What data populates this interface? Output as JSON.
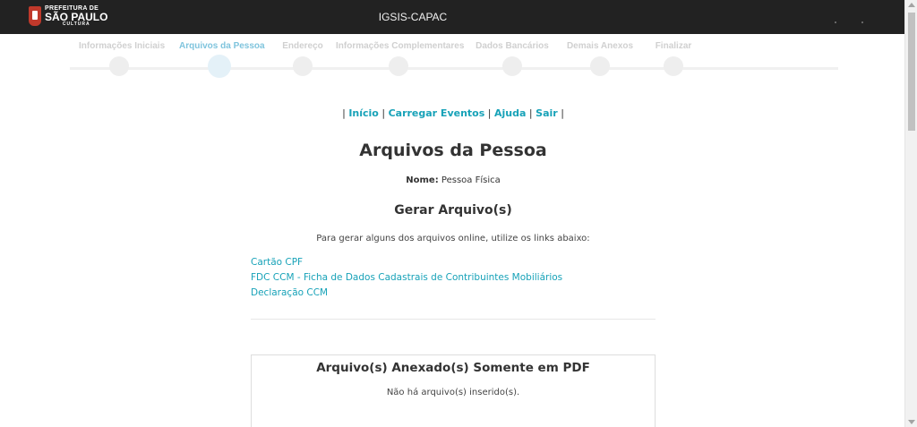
{
  "header": {
    "logo": {
      "line1": "PREFEITURA DE",
      "line2": "SÃO PAULO",
      "line3": "CULTURA"
    },
    "title": "IGSIS-CAPAC"
  },
  "wizard": {
    "steps": [
      {
        "label": "Informações Iniciais",
        "active": false
      },
      {
        "label": "Arquivos da Pessoa",
        "active": true
      },
      {
        "label": "Endereço",
        "active": false
      },
      {
        "label": "Informações Complementares",
        "active": false
      },
      {
        "label": "Dados Bancários",
        "active": false
      },
      {
        "label": "Demais Anexos",
        "active": false
      },
      {
        "label": "Finalizar",
        "active": false
      }
    ]
  },
  "topnav": {
    "separator": "|",
    "links": [
      "Início",
      "Carregar Eventos",
      "Ajuda",
      "Sair"
    ]
  },
  "page": {
    "title": "Arquivos da Pessoa",
    "name_label": "Nome:",
    "name_value": "Pessoa Física"
  },
  "generate": {
    "title": "Gerar Arquivo(s)",
    "instructions": "Para gerar alguns dos arquivos online, utilize os links abaixo:",
    "links": [
      "Cartão CPF",
      "FDC CCM - Ficha de Dados Cadastrais de Contribuintes Mobiliários",
      "Declaração CCM"
    ]
  },
  "attached": {
    "title": "Arquivo(s) Anexado(s) Somente em PDF",
    "empty_message": "Não há arquivo(s) inserido(s)."
  },
  "colors": {
    "header_bg": "#222222",
    "link": "#17a2b8",
    "active_step": "#7fc4dd"
  }
}
